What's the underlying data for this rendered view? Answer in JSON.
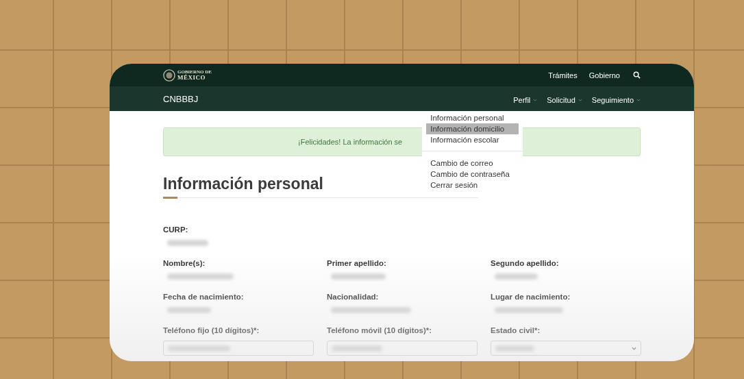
{
  "header": {
    "logo": {
      "line1": "GOBIERNO DE",
      "line2": "MÉXICO"
    },
    "links": [
      "Trámites",
      "Gobierno"
    ]
  },
  "nav": {
    "brand": "CNBBBJ",
    "menus": [
      {
        "label": "Perfil",
        "dropdown": {
          "groups": [
            [
              {
                "label": "Información personal",
                "selected": false
              },
              {
                "label": "Información domicilio",
                "selected": true
              },
              {
                "label": "Información escolar",
                "selected": false
              }
            ],
            [
              {
                "label": "Cambio de correo",
                "selected": false
              },
              {
                "label": "Cambio de contraseña",
                "selected": false
              },
              {
                "label": "Cerrar sesión",
                "selected": false
              }
            ]
          ]
        }
      },
      {
        "label": "Solicitud"
      },
      {
        "label": "Seguimiento"
      }
    ]
  },
  "alert": {
    "text": "¡Felicidades! La información se"
  },
  "heading": "Información personal",
  "form_rows": [
    [
      {
        "label": "CURP:",
        "kind": "text"
      }
    ],
    [
      {
        "label": "Nombre(s):",
        "kind": "text"
      },
      {
        "label": "Primer apellido:",
        "kind": "text"
      },
      {
        "label": "Segundo apellido:",
        "kind": "text"
      }
    ],
    [
      {
        "label": "Fecha de nacimiento:",
        "kind": "text"
      },
      {
        "label": "Nacionalidad:",
        "kind": "text"
      },
      {
        "label": "Lugar de nacimiento:",
        "kind": "text"
      }
    ],
    [
      {
        "label": "Teléfono fijo (10 dígitos)*:",
        "kind": "input"
      },
      {
        "label": "Teléfono móvil (10 dígitos)*:",
        "kind": "input"
      },
      {
        "label": "Estado civil*:",
        "kind": "select"
      }
    ]
  ]
}
